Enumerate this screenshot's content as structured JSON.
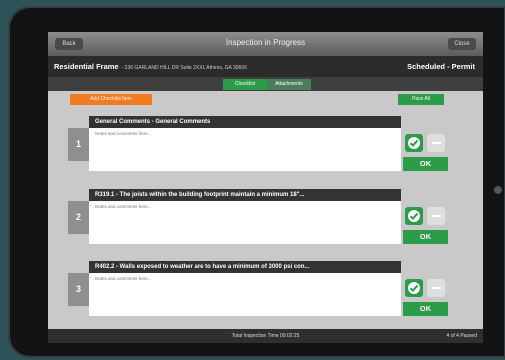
{
  "header": {
    "back_label": "Back",
    "title": "Inspection in Progress",
    "close_label": "Close"
  },
  "info": {
    "frame_title": "Residential Frame",
    "address": "- 236 GARLAND HILL DR Suite 2XXL Athens, GA 30606",
    "status": "Scheduled - Permit"
  },
  "tabs": [
    {
      "label": "Checklist",
      "active": true
    },
    {
      "label": "Attachments",
      "active": false
    }
  ],
  "actions": {
    "add_label": "Add Checklist Item",
    "pass_all_label": "Pass All"
  },
  "items": [
    {
      "number": "1",
      "title": "General Comments - General Comments",
      "notes": "Notes and comments here...",
      "result": "OK"
    },
    {
      "number": "2",
      "title": "R319.1 - The joists within the building footprint maintain a minimum 18\"...",
      "notes": "Notes and comments here...",
      "result": "OK"
    },
    {
      "number": "3",
      "title": "R402.2 - Walls exposed to weather are to have a minimum of 3000 psi con...",
      "notes": "Notes and comments here...",
      "result": "OK"
    }
  ],
  "footer": {
    "total_time": "Total Inspection Time 00:02:25",
    "passed_count": "4 of 4 Passed"
  },
  "colors": {
    "accent_green": "#2b9c48",
    "accent_orange": "#f27b21",
    "dark_bar": "#2b2b2b"
  }
}
